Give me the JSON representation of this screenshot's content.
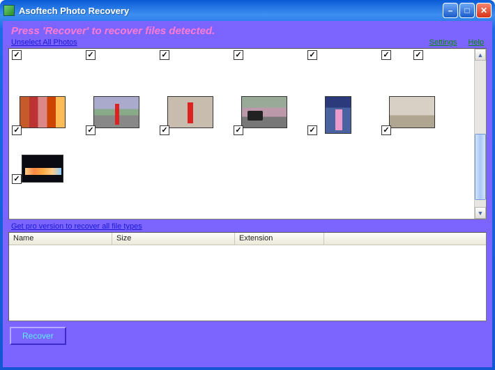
{
  "titlebar": {
    "title": "Asoftech Photo Recovery"
  },
  "instruction": "Press 'Recover' to recover files detected.",
  "links": {
    "unselect": "Unselect All Photos",
    "settings": "Settings",
    "help": "Help",
    "pro": "Get pro version to recover all file types"
  },
  "table": {
    "columns": {
      "name": "Name",
      "size": "Size",
      "extension": "Extension"
    }
  },
  "buttons": {
    "recover": "Recover"
  },
  "photos": {
    "partial_row_count": 7,
    "thumb_row_count": 6,
    "extra_row_count": 1
  }
}
